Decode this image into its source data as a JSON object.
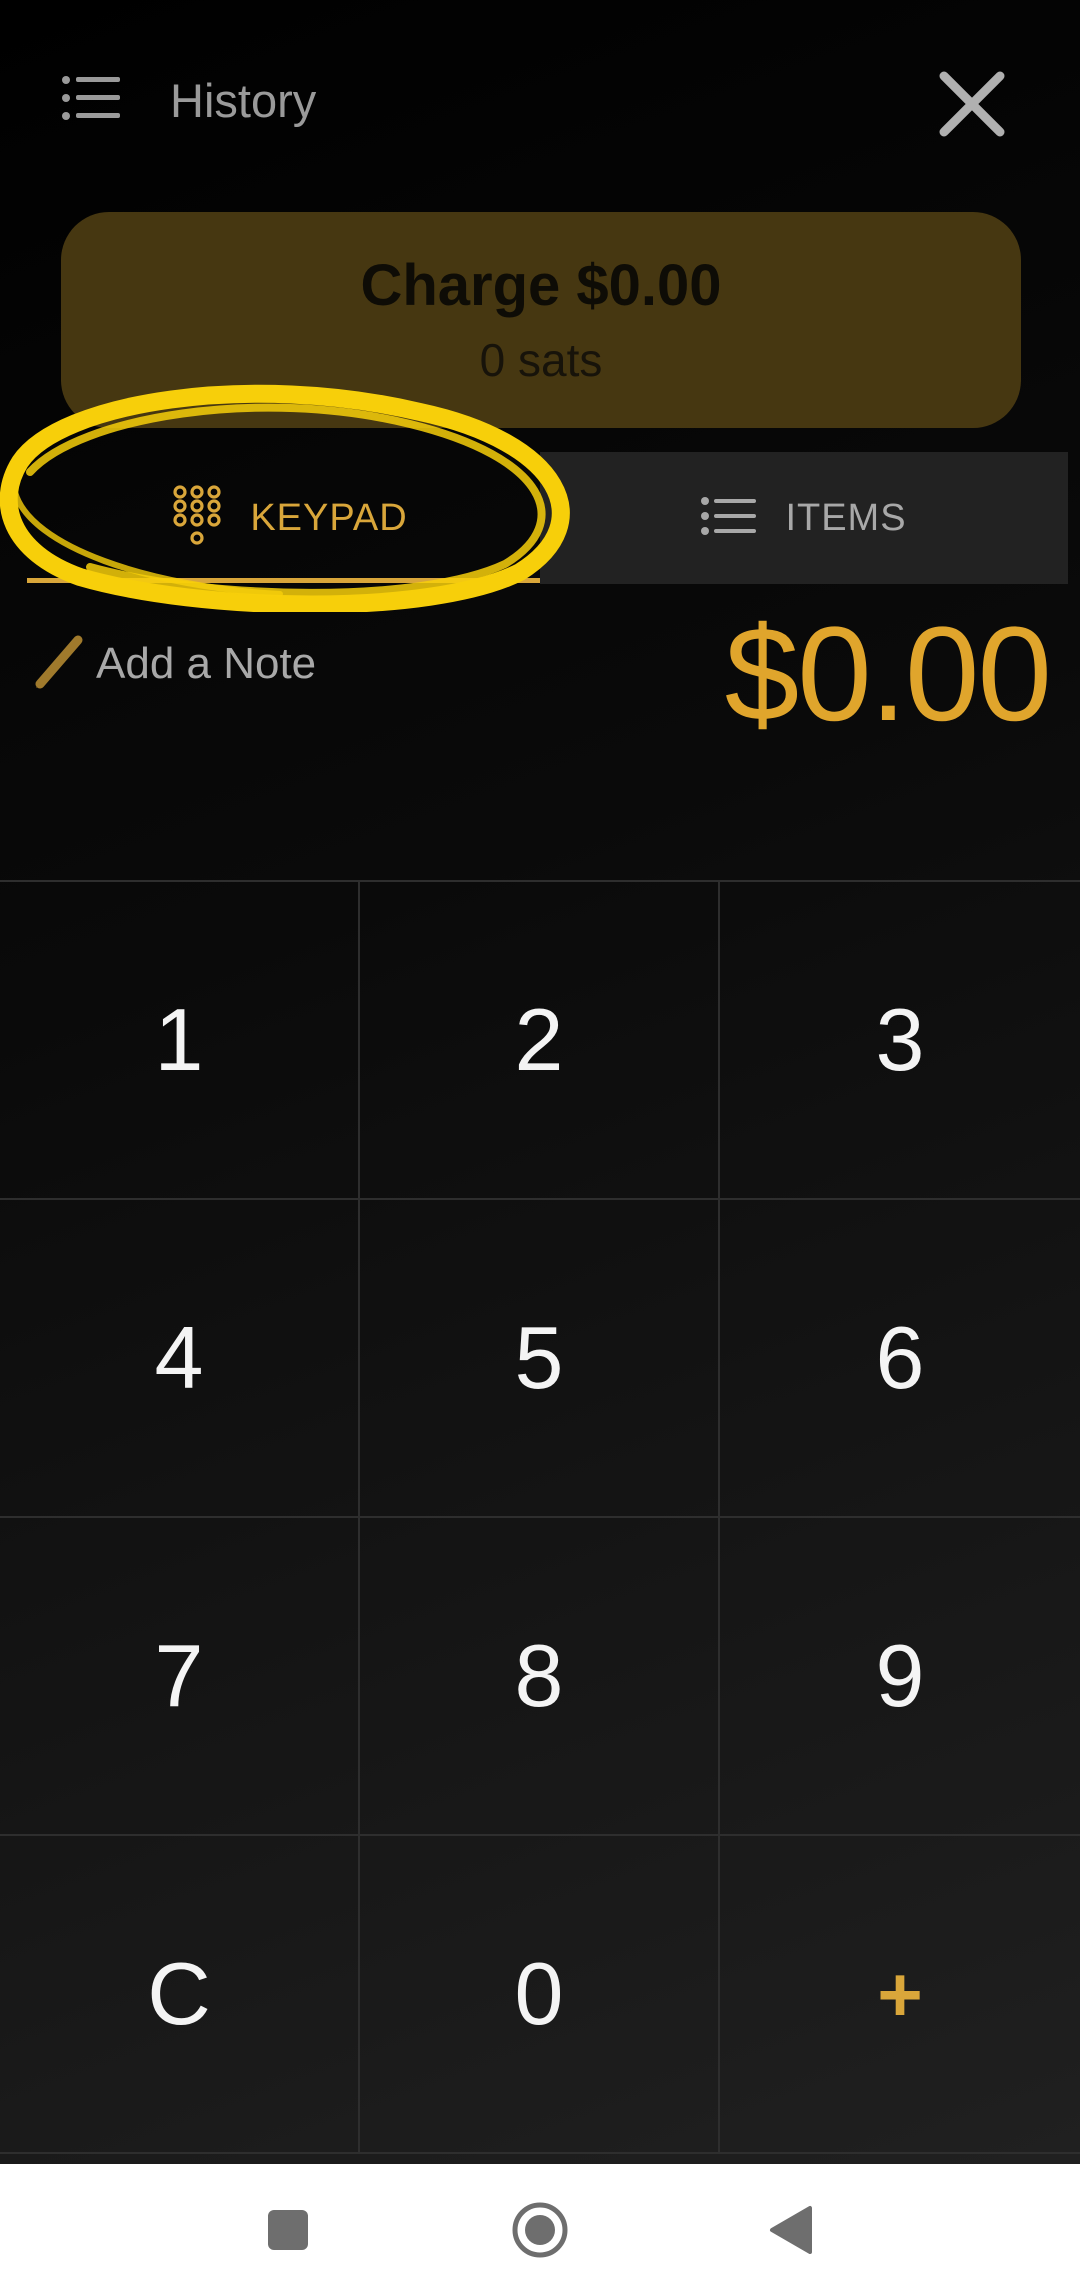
{
  "header": {
    "history_label": "History",
    "menu_icon": "list-icon",
    "close_icon": "close-icon"
  },
  "charge": {
    "title": "Charge $0.00",
    "sats": "0 sats",
    "background_color": "#463711"
  },
  "tabs": [
    {
      "label": "KEYPAD",
      "icon": "keypad-dots-icon",
      "active": true
    },
    {
      "label": "ITEMS",
      "icon": "list-icon",
      "active": false
    }
  ],
  "note": {
    "label": "Add a Note",
    "icon": "pencil-icon"
  },
  "amount": "$0.00",
  "keypad": {
    "keys": [
      "1",
      "2",
      "3",
      "4",
      "5",
      "6",
      "7",
      "8",
      "9",
      "C",
      "0",
      "+"
    ]
  },
  "colors": {
    "accent": "#d9a63a",
    "amount": "#e0a52c",
    "annotation": "#f7cf0a"
  },
  "system_nav": {
    "icons": [
      "recents-square-icon",
      "home-circle-icon",
      "back-triangle-icon"
    ]
  }
}
